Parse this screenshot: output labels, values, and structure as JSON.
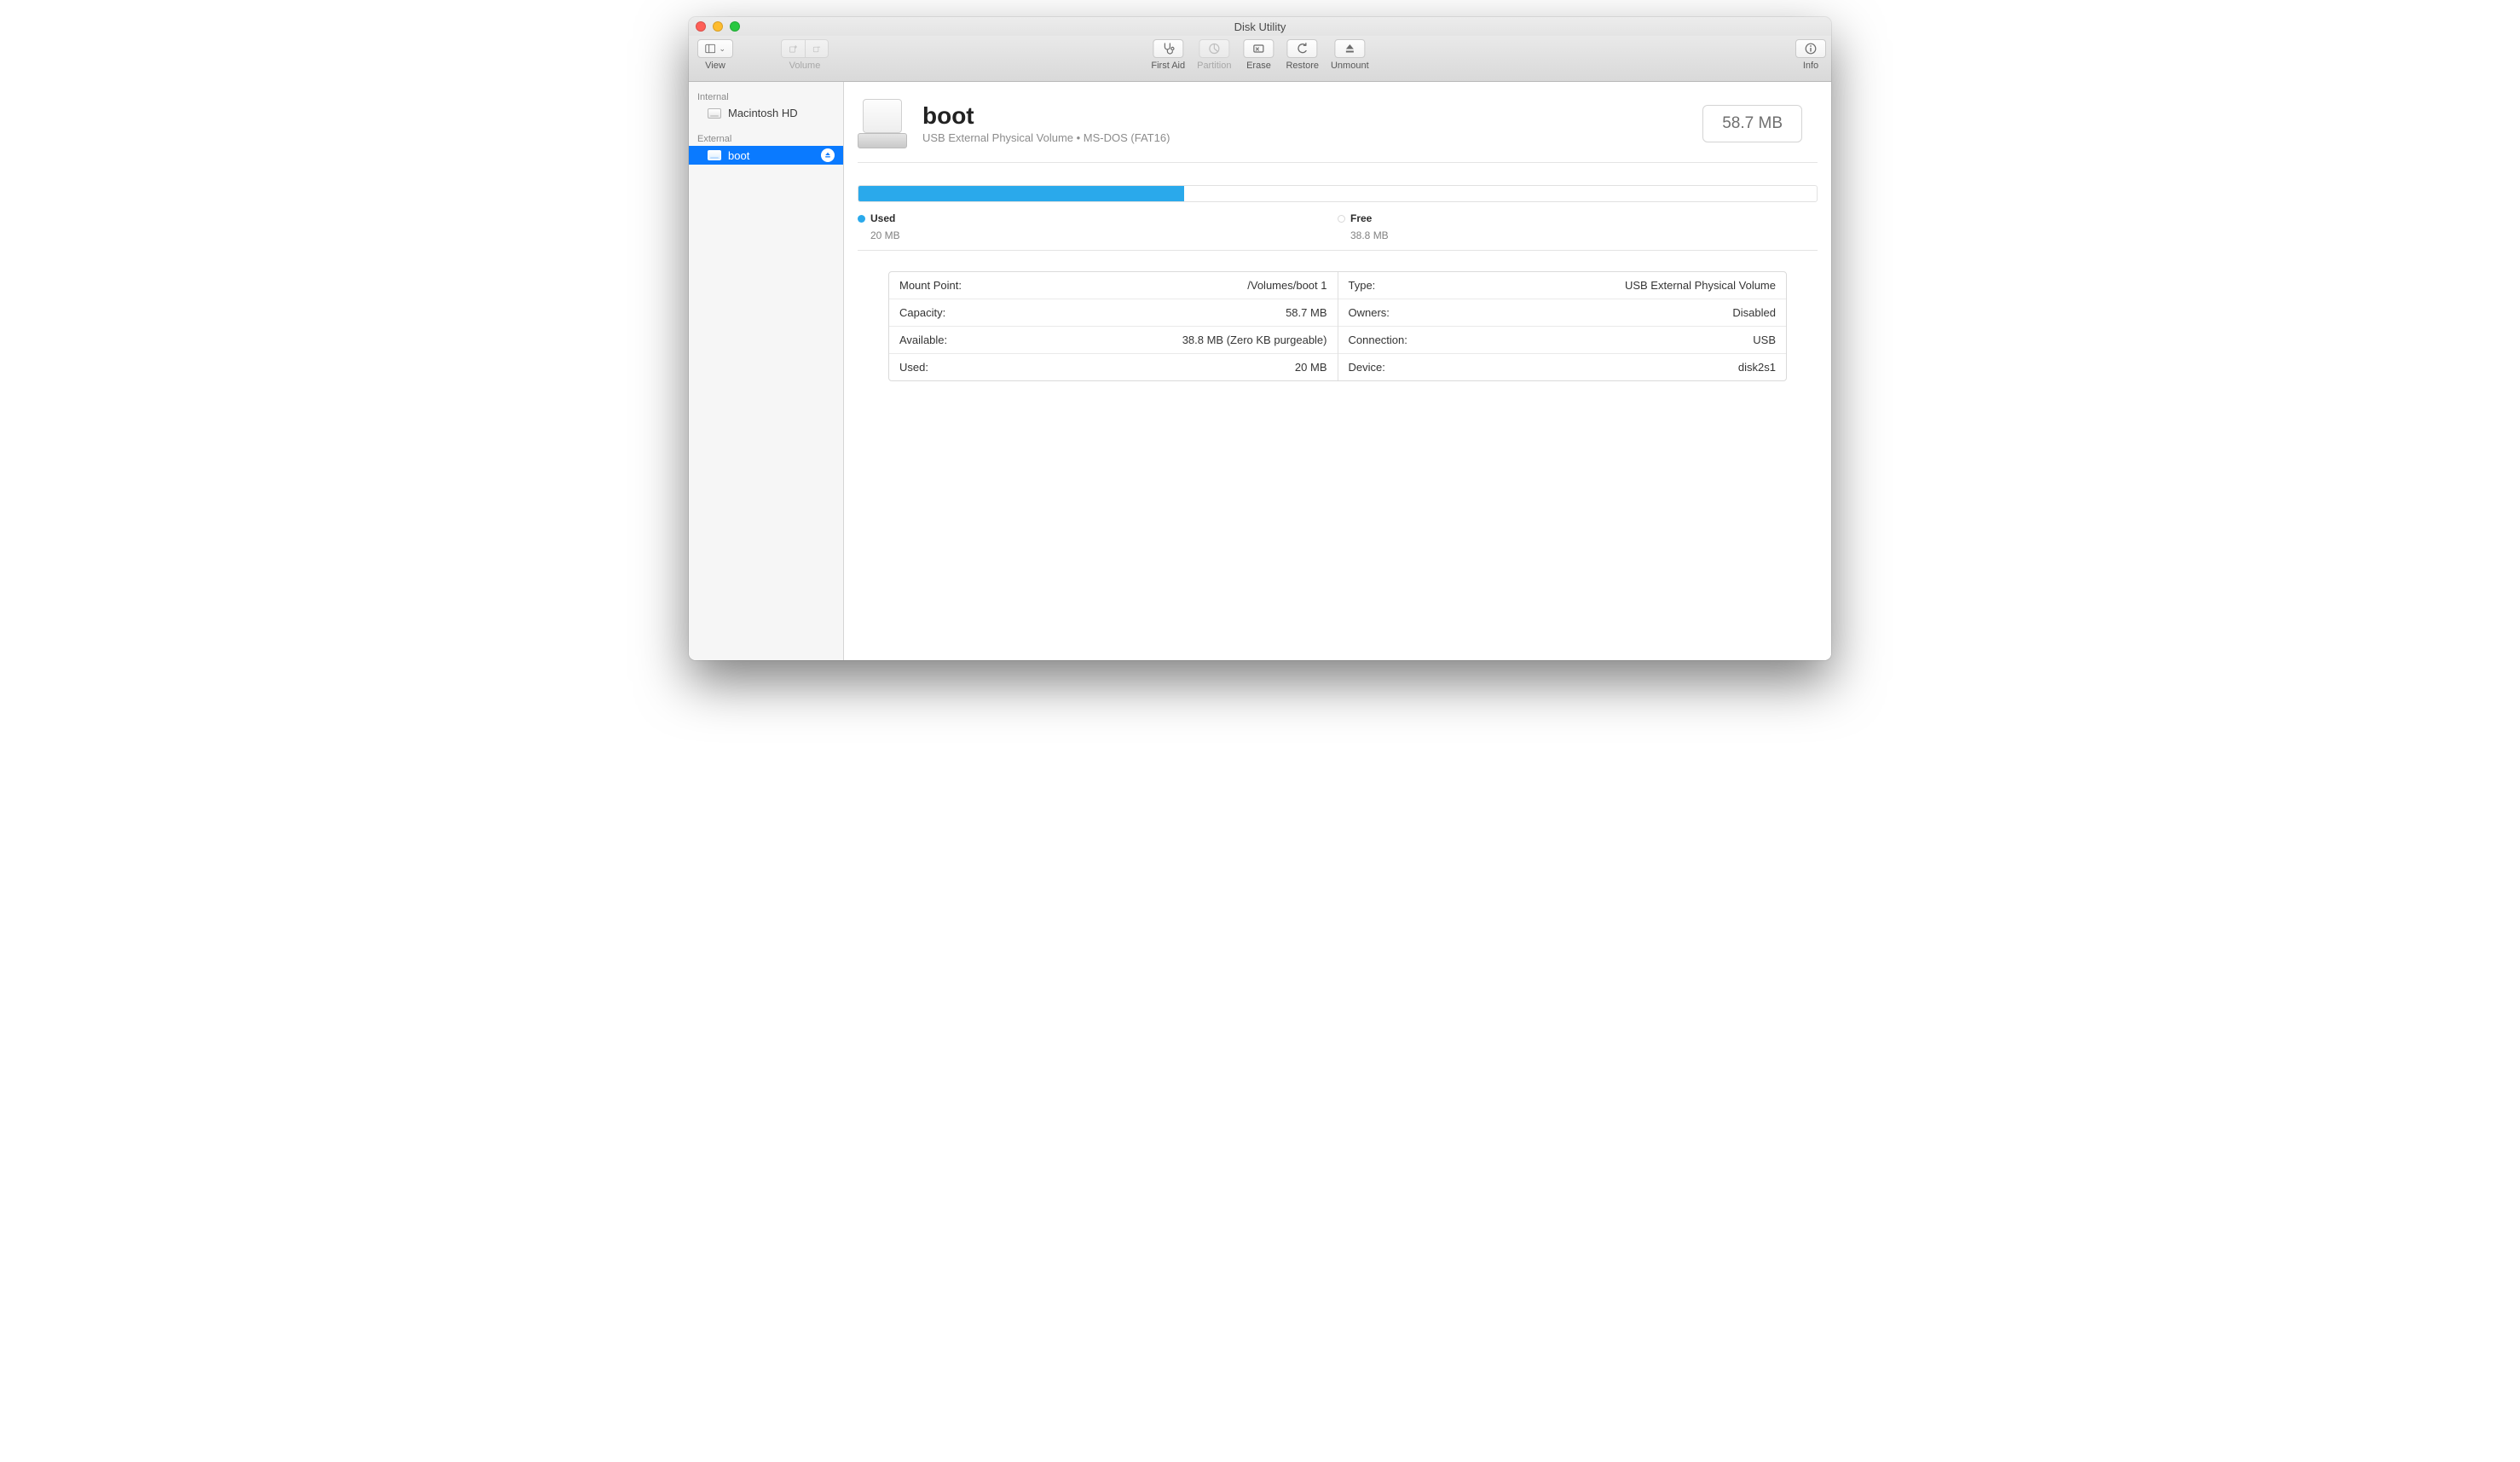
{
  "window": {
    "title": "Disk Utility"
  },
  "toolbar": {
    "view_label": "View",
    "volume_label": "Volume",
    "first_aid_label": "First Aid",
    "partition_label": "Partition",
    "erase_label": "Erase",
    "restore_label": "Restore",
    "unmount_label": "Unmount",
    "info_label": "Info"
  },
  "sidebar": {
    "internal_header": "Internal",
    "external_header": "External",
    "internal_items": [
      {
        "label": "Macintosh HD"
      }
    ],
    "external_items": [
      {
        "label": "boot",
        "selected": true,
        "ejectable": true
      }
    ]
  },
  "volume": {
    "name": "boot",
    "subtitle": "USB External Physical Volume • MS-DOS (FAT16)",
    "size_display": "58.7 MB"
  },
  "usage": {
    "used_label": "Used",
    "used_value": "20 MB",
    "free_label": "Free",
    "free_value": "38.8 MB",
    "used_percent": 34
  },
  "details": {
    "left": [
      {
        "k": "Mount Point:",
        "v": "/Volumes/boot 1"
      },
      {
        "k": "Capacity:",
        "v": "58.7 MB"
      },
      {
        "k": "Available:",
        "v": "38.8 MB (Zero KB purgeable)"
      },
      {
        "k": "Used:",
        "v": "20 MB"
      }
    ],
    "right": [
      {
        "k": "Type:",
        "v": "USB External Physical Volume"
      },
      {
        "k": "Owners:",
        "v": "Disabled"
      },
      {
        "k": "Connection:",
        "v": "USB"
      },
      {
        "k": "Device:",
        "v": "disk2s1"
      }
    ]
  }
}
